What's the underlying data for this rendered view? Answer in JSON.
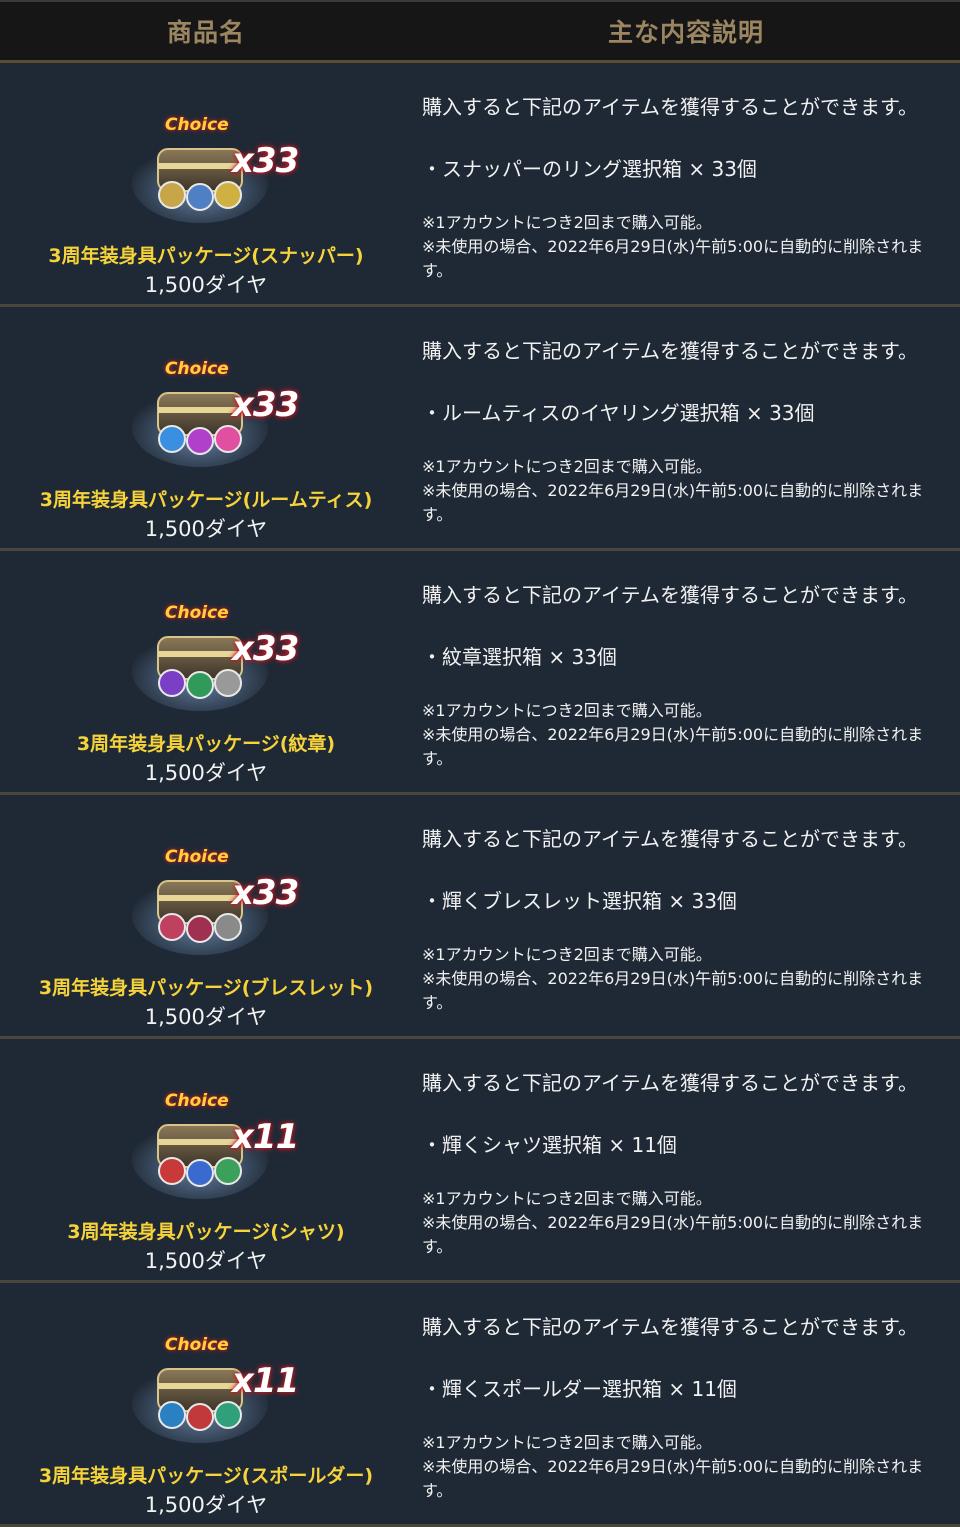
{
  "header": {
    "col1": "商品名",
    "col2": "主な内容説明"
  },
  "products": [
    {
      "name": "3周年装身具パッケージ(スナッパー)",
      "price": "1,500ダイヤ",
      "badge": "Choice",
      "count": "x33",
      "icon": "ring-chest-icon",
      "lead": "購入すると下記のアイテムを獲得することができます。",
      "item": "・スナッパーのリング選択箱 × 33個",
      "note1": "※1アカウントにつき2回まで購入可能。",
      "note2": "※未使用の場合、2022年6月29日(水)午前5:00に自動的に削除されます。"
    },
    {
      "name": "3周年装身具パッケージ(ルームティス)",
      "price": "1,500ダイヤ",
      "badge": "Choice",
      "count": "x33",
      "icon": "earring-chest-icon",
      "lead": "購入すると下記のアイテムを獲得することができます。",
      "item": "・ルームティスのイヤリング選択箱 × 33個",
      "note1": "※1アカウントにつき2回まで購入可能。",
      "note2": "※未使用の場合、2022年6月29日(水)午前5:00に自動的に削除されます。"
    },
    {
      "name": "3周年装身具パッケージ(紋章)",
      "price": "1,500ダイヤ",
      "badge": "Choice",
      "count": "x33",
      "icon": "emblem-chest-icon",
      "lead": "購入すると下記のアイテムを獲得することができます。",
      "item": "・紋章選択箱 × 33個",
      "note1": "※1アカウントにつき2回まで購入可能。",
      "note2": "※未使用の場合、2022年6月29日(水)午前5:00に自動的に削除されます。"
    },
    {
      "name": "3周年装身具パッケージ(ブレスレット)",
      "price": "1,500ダイヤ",
      "badge": "Choice",
      "count": "x33",
      "icon": "bracelet-chest-icon",
      "lead": "購入すると下記のアイテムを獲得することができます。",
      "item": "・輝くブレスレット選択箱 × 33個",
      "note1": "※1アカウントにつき2回まで購入可能。",
      "note2": "※未使用の場合、2022年6月29日(水)午前5:00に自動的に削除されます。"
    },
    {
      "name": "3周年装身具パッケージ(シャツ)",
      "price": "1,500ダイヤ",
      "badge": "Choice",
      "count": "x11",
      "icon": "shirt-chest-icon",
      "lead": "購入すると下記のアイテムを獲得することができます。",
      "item": "・輝くシャツ選択箱 × 11個",
      "note1": "※1アカウントにつき2回まで購入可能。",
      "note2": "※未使用の場合、2022年6月29日(水)午前5:00に自動的に削除されます。"
    },
    {
      "name": "3周年装身具パッケージ(スポールダー)",
      "price": "1,500ダイヤ",
      "badge": "Choice",
      "count": "x11",
      "icon": "pauldron-chest-icon",
      "lead": "購入すると下記のアイテムを獲得することができます。",
      "item": "・輝くスポールダー選択箱 × 11個",
      "note1": "※1アカウントにつき2回まで購入可能。",
      "note2": "※未使用の場合、2022年6月29日(水)午前5:00に自動的に削除されます。"
    }
  ],
  "colors": {
    "background": "#1f2935",
    "header_bg": "#161616",
    "header_text": "#9c8662",
    "product_name": "#f6d33a",
    "text": "#f1f1f1",
    "divider": "#4a463c"
  }
}
